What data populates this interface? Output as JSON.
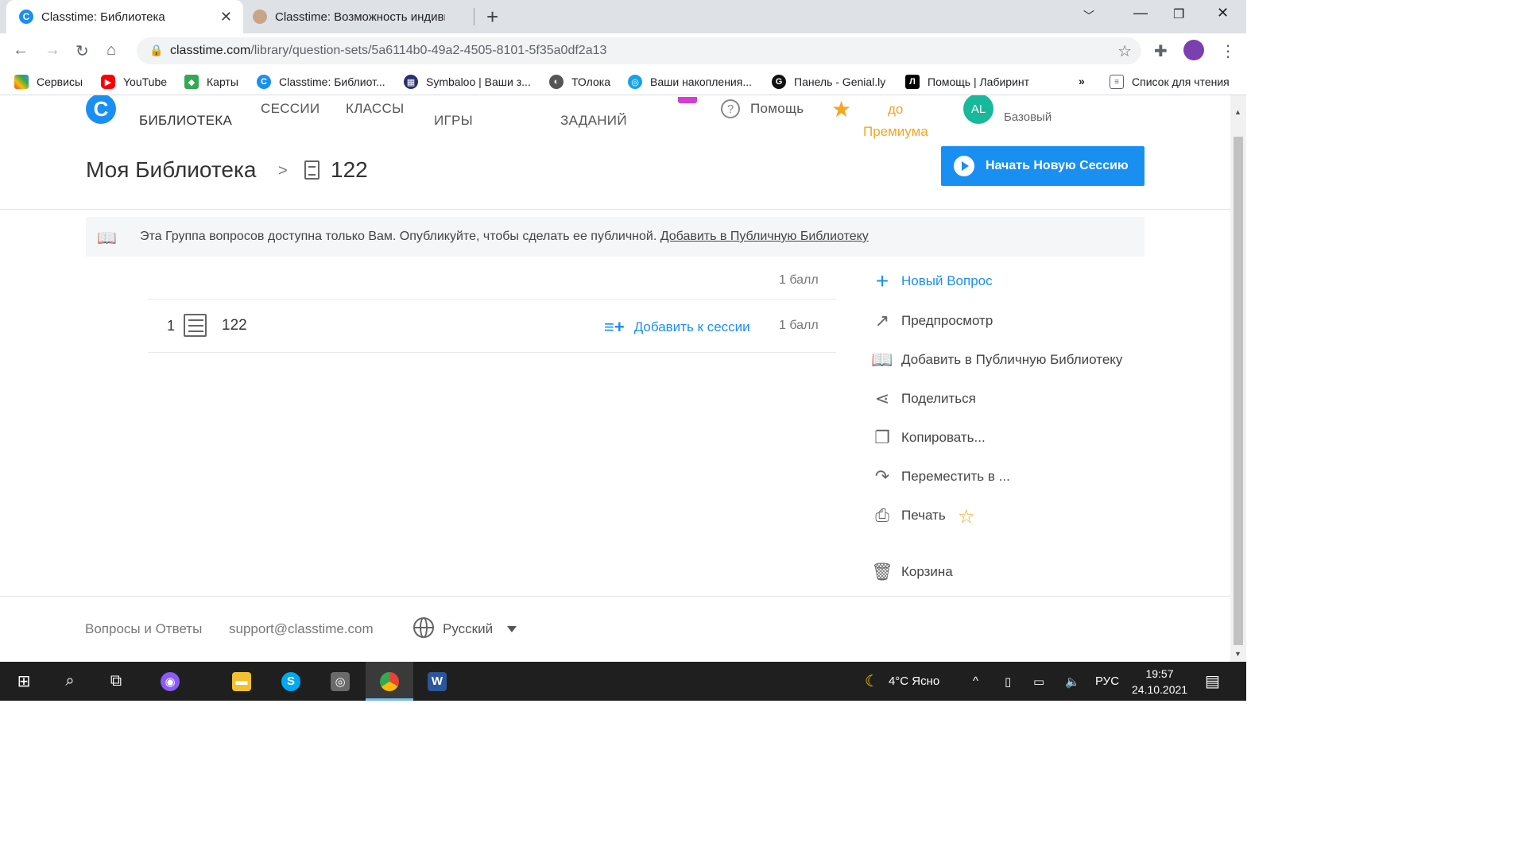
{
  "browser": {
    "tabs": [
      {
        "title": "Classtime: Библиотека",
        "active": true
      },
      {
        "title": "Classtime: Возможность индиви",
        "active": false
      }
    ],
    "url_domain": "classtime.com",
    "url_path": "/library/question-sets/5a6114b0-49a2-4505-8101-5f35a0df2a13",
    "bookmarks": [
      "Сервисы",
      "YouTube",
      "Карты",
      "Classtime: Библиот...",
      "Symbaloo | Ваши з...",
      "ТОлока",
      "Ваши накопления...",
      "Панель - Genial.ly",
      "Помощь | Лабиринт"
    ],
    "bookmarks_more": "»",
    "reading_list": "Список для чтения"
  },
  "app": {
    "logo_letter": "C",
    "nav": {
      "library": "БИБЛИОТЕКА",
      "sessions": "СЕССИИ",
      "classes": "КЛАССЫ",
      "games": "ИГРЫ",
      "tasks": "ЗАДАНИЙ"
    },
    "help": "Помощь",
    "premium_line1": "до",
    "premium_line2": "Премиума",
    "user_initials": "AL",
    "user_plan": "Базовый",
    "accent": "#1a8ff2",
    "premium_color": "#f5a623"
  },
  "breadcrumb": {
    "root": "Моя Библиотека",
    "separator": ">",
    "current": "122"
  },
  "start_session_button": "Начать Новую Сессию",
  "notice": {
    "text": "Эта Группа вопросов доступна только Вам. Опубликуйте, чтобы сделать ее публичной.",
    "link": "Добавить в Публичную Библиотеку"
  },
  "question_list": {
    "total_points": "1 балл",
    "items": [
      {
        "number": "1",
        "title": "122",
        "add_to_session": "Добавить к сессии",
        "points": "1 балл"
      }
    ]
  },
  "sidebar": {
    "new_question": "Новый Вопрос",
    "preview": "Предпросмотр",
    "add_public": "Добавить в Публичную Библиотеку",
    "share": "Поделиться",
    "copy": "Копировать...",
    "move": "Переместить в ...",
    "print": "Печать",
    "trash": "Корзина"
  },
  "footer": {
    "faq": "Вопросы и Ответы",
    "email": "support@classtime.com",
    "language": "Русский"
  },
  "taskbar": {
    "weather": "4°C  Ясно",
    "lang": "РУС",
    "time": "19:57",
    "date": "24.10.2021"
  }
}
